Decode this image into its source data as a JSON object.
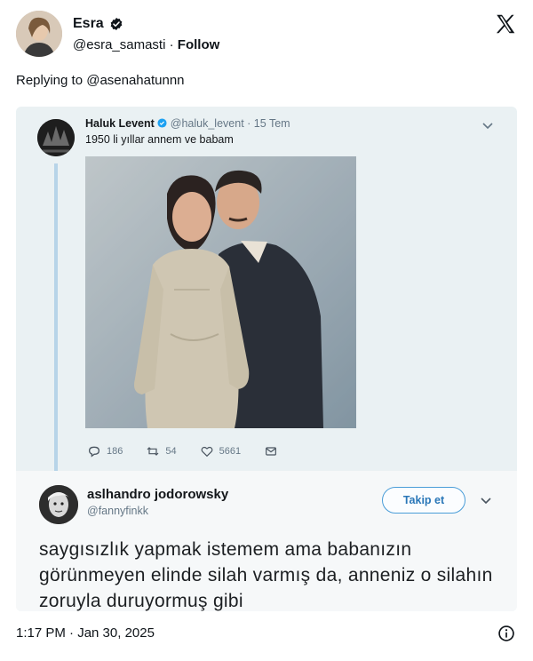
{
  "post": {
    "author_name": "Esra",
    "author_handle": "@esra_samasti",
    "separator": "·",
    "follow_label": "Follow",
    "replying_to": "Replying to @asenahatunnn",
    "timestamp": "1:17 PM · Jan 30, 2025"
  },
  "embedded_tweet": {
    "name": "Haluk Levent",
    "handle": "@haluk_levent",
    "date": "· 15 Tem",
    "text": "1950 li yıllar annem ve babam",
    "replies": "186",
    "retweets": "54",
    "likes": "5661"
  },
  "embedded_reply": {
    "name": "aslhandro jodorowsky",
    "handle": "@fannyfinkk",
    "follow_label": "Takip et",
    "text": "saygısızlık yapmak istemem ama babanızın görünmeyen elinde silah varmış da, anneniz o silahın zoruyla duruyormuş gibi"
  },
  "colors": {
    "verified": "#0f1419",
    "link_blue": "#2a77b8",
    "embed_bg": "#eaf1f3"
  }
}
